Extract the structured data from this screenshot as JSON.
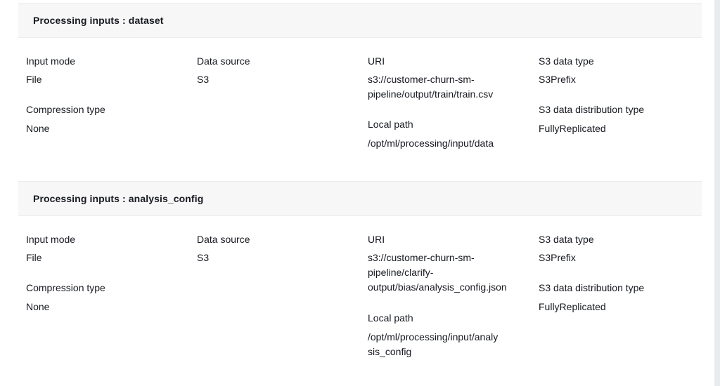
{
  "panels": [
    {
      "title": "Processing inputs : dataset",
      "input_mode_label": "Input mode",
      "input_mode_value": "File",
      "compression_label": "Compression type",
      "compression_value": "None",
      "data_source_label": "Data source",
      "data_source_value": "S3",
      "uri_label": "URI",
      "uri_value_lines": [
        "s3://customer-churn-sm-",
        "pipeline/output/train/train.csv"
      ],
      "local_path_label": "Local path",
      "local_path_lines": [
        "/opt/ml/processing/input/data"
      ],
      "s3_data_type_label": "S3 data type",
      "s3_data_type_value": "S3Prefix",
      "s3_dist_label": "S3 data distribution type",
      "s3_dist_value": "FullyReplicated"
    },
    {
      "title": "Processing inputs : analysis_config",
      "input_mode_label": "Input mode",
      "input_mode_value": "File",
      "compression_label": "Compression type",
      "compression_value": "None",
      "data_source_label": "Data source",
      "data_source_value": "S3",
      "uri_label": "URI",
      "uri_value_lines": [
        "s3://customer-churn-sm-",
        "pipeline/clarify-",
        "output/bias/analysis_config.json"
      ],
      "local_path_label": "Local path",
      "local_path_lines": [
        "/opt/ml/processing/input/analy",
        "sis_config"
      ],
      "s3_data_type_label": "S3 data type",
      "s3_data_type_value": "S3Prefix",
      "s3_dist_label": "S3 data distribution type",
      "s3_dist_value": "FullyReplicated"
    }
  ]
}
